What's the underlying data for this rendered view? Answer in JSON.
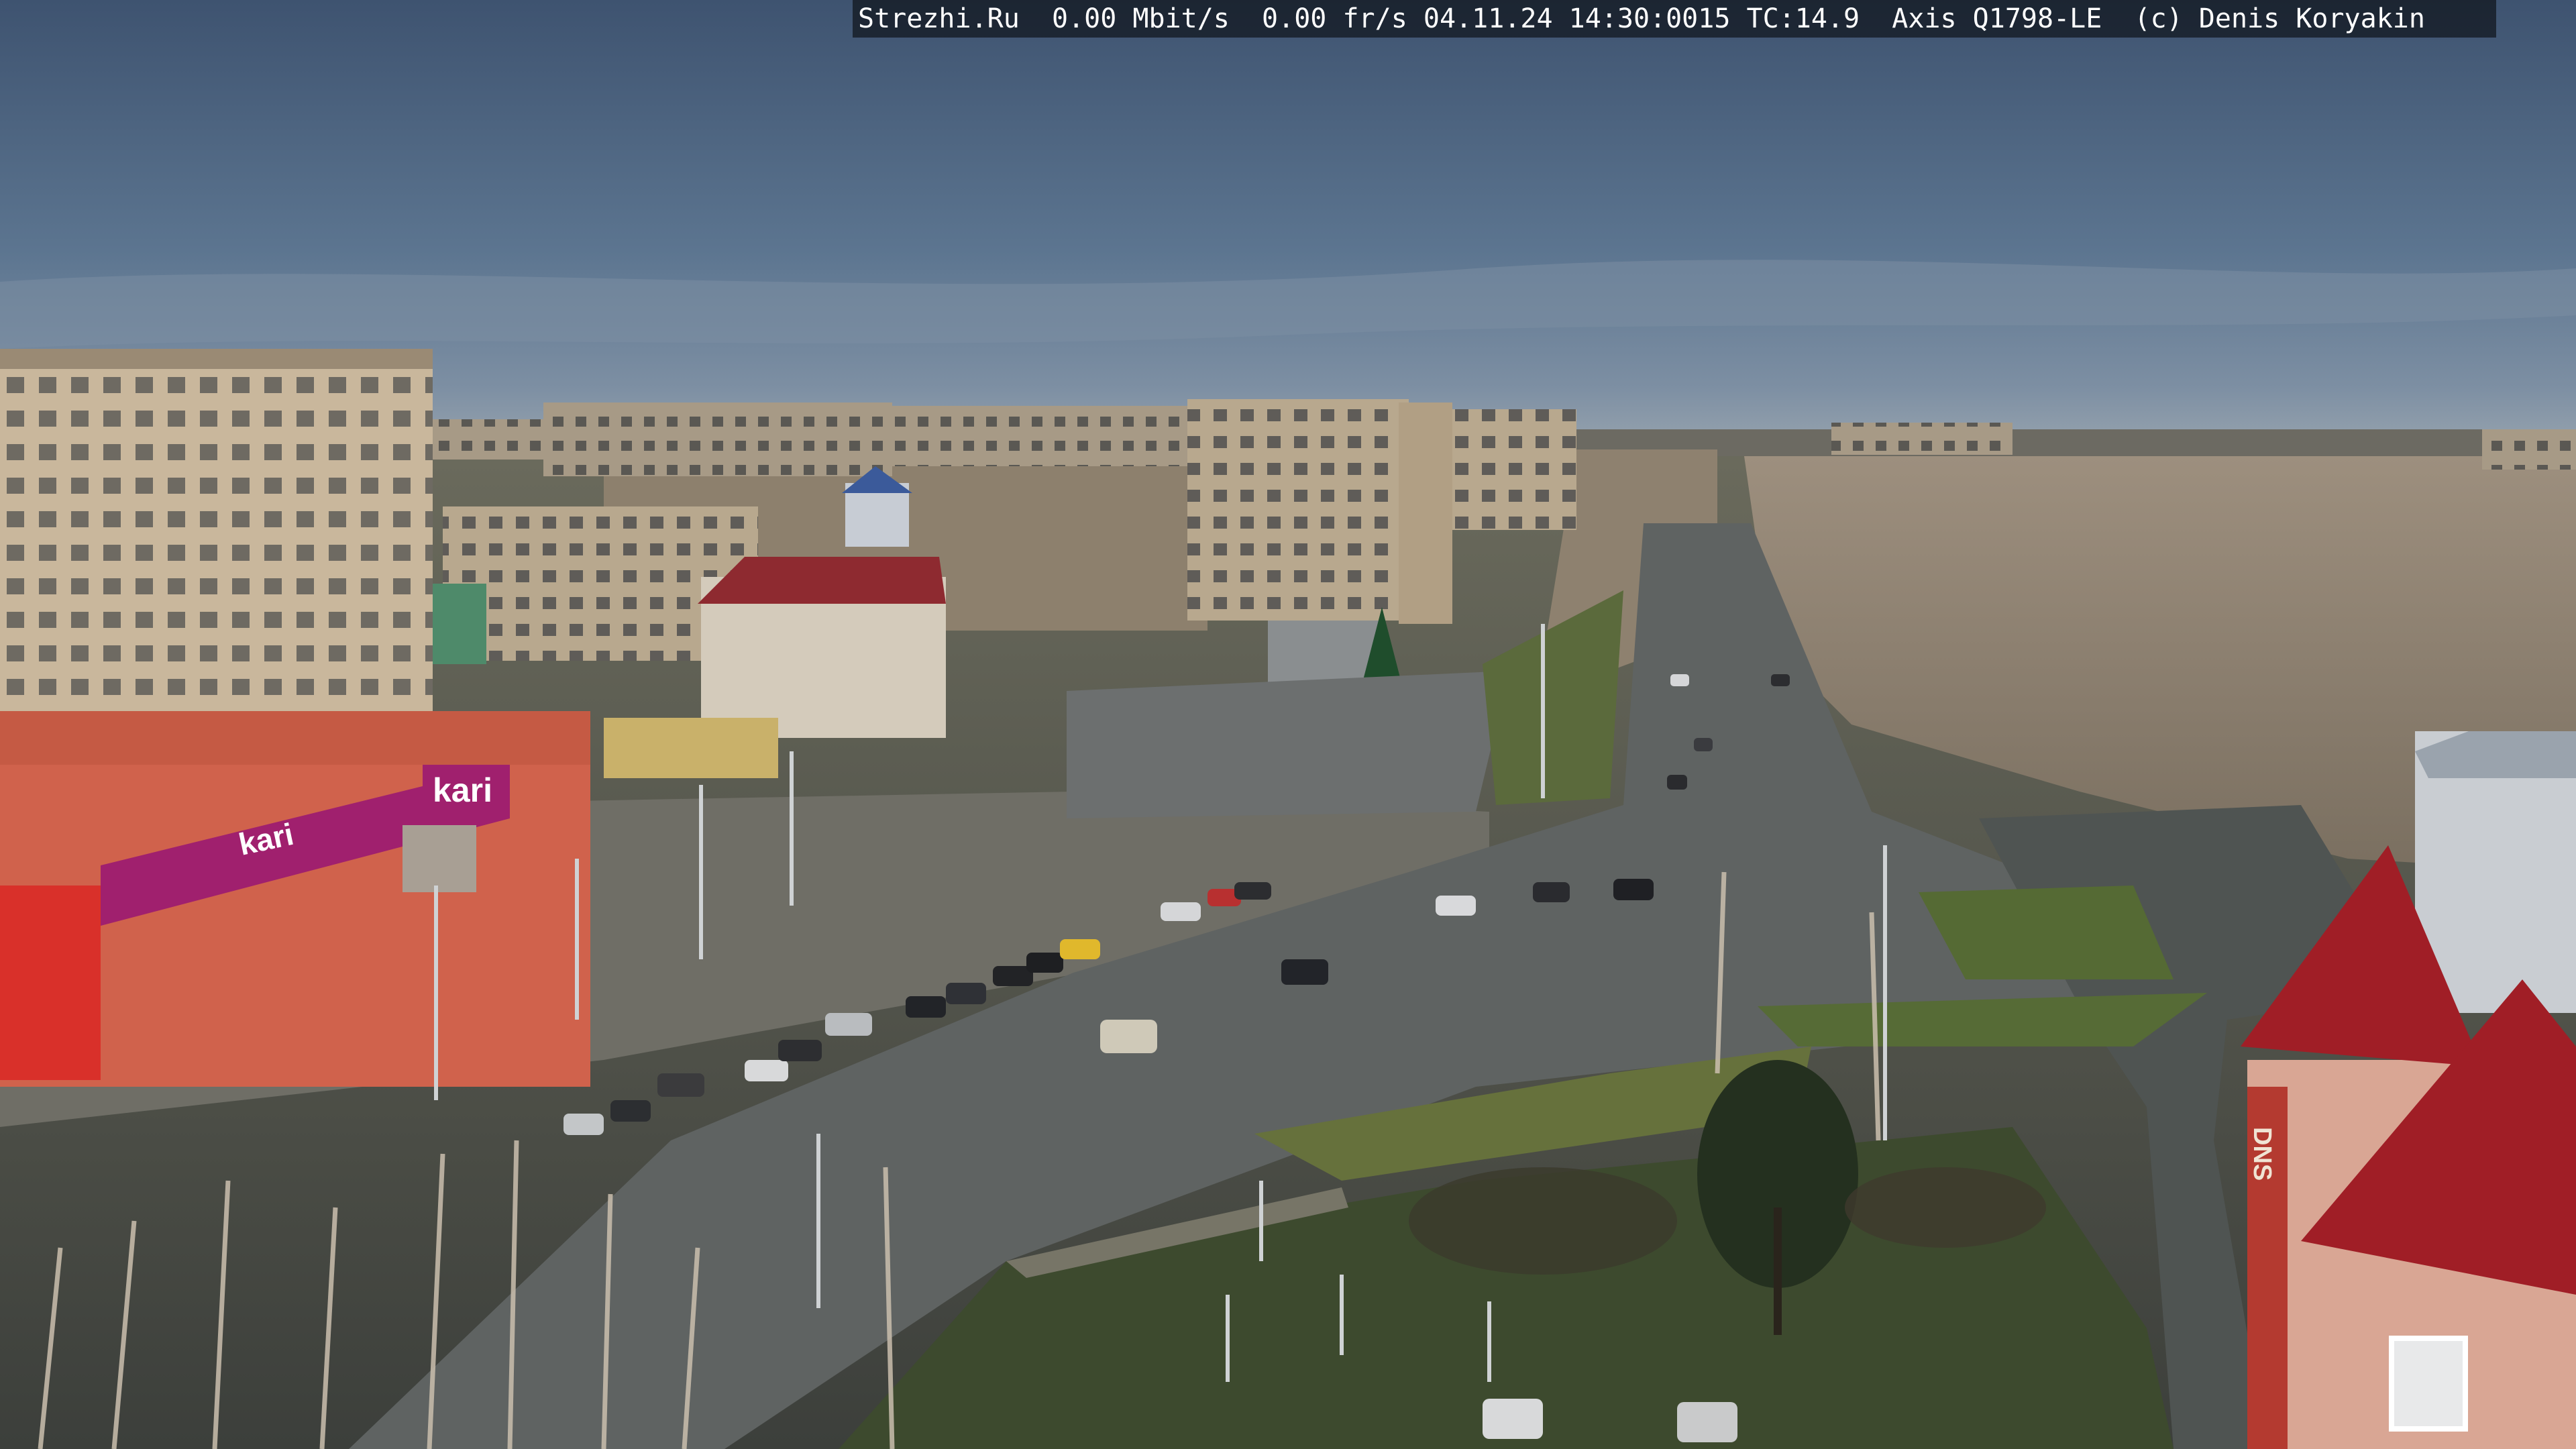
{
  "osd": {
    "text": "Strezhi.Ru  0.00 Mbit/s  0.00 fr/s 04.11.24 14:30:0015 TC:14.9  Axis Q1798-LE  (c) Denis Koryakin"
  },
  "signs": {
    "kari_main": "kari",
    "kari_tower": "kari",
    "dns": "DNS"
  },
  "colors": {
    "sky_top": "#3e5370",
    "sky_mid": "#5c7590",
    "sky_horizon": "#8a9aaa",
    "road": "#5f6362",
    "kari_magenta": "#a0206e",
    "store_red": "#d9302a",
    "roof_red": "#a01e26"
  }
}
